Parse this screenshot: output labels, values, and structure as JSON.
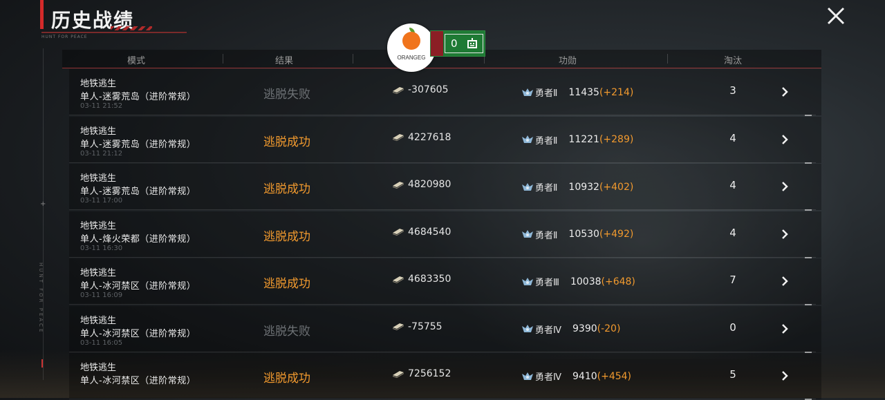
{
  "page": {
    "title": "历史战绩",
    "caption": "HUNT FOR PEACE"
  },
  "side_text": "HUNT FOR PEACE",
  "badge": {
    "brand": "ORANGEG",
    "score": "0"
  },
  "columns": {
    "mode": "模式",
    "result": "结果",
    "merit": "功勋",
    "eliminations": "淘汰"
  },
  "icons": {
    "close": "close-icon",
    "cash": "cash-icon",
    "rank": "rank-badge-icon",
    "row_arrow": "chevron-right-icon",
    "robot": "robot-icon"
  },
  "colors": {
    "success": "#f29a2e",
    "failure": "#6e7276",
    "accent_red": "#d42a2a",
    "delta": "#f29a2e"
  },
  "matches": [
    {
      "mode_line1": "地铁逃生",
      "mode_line2": "单人-迷雾荒岛（进阶常规）",
      "time": "03-11 21:52",
      "result": "逃脱失败",
      "status": "fail",
      "money": "-307605",
      "rank": "勇者Ⅱ",
      "merit": "11435",
      "merit_delta": "(+214)",
      "eliminations": "3"
    },
    {
      "mode_line1": "地铁逃生",
      "mode_line2": "单人-迷雾荒岛（进阶常规）",
      "time": "03-11 21:12",
      "result": "逃脱成功",
      "status": "ok",
      "money": "4227618",
      "rank": "勇者Ⅱ",
      "merit": "11221",
      "merit_delta": "(+289)",
      "eliminations": "4"
    },
    {
      "mode_line1": "地铁逃生",
      "mode_line2": "单人-迷雾荒岛（进阶常规）",
      "time": "03-11 17:00",
      "result": "逃脱成功",
      "status": "ok",
      "money": "4820980",
      "rank": "勇者Ⅱ",
      "merit": "10932",
      "merit_delta": "(+402)",
      "eliminations": "4"
    },
    {
      "mode_line1": "地铁逃生",
      "mode_line2": "单人-烽火荣都（进阶常规）",
      "time": "03-11 16:30",
      "result": "逃脱成功",
      "status": "ok",
      "money": "4684540",
      "rank": "勇者Ⅱ",
      "merit": "10530",
      "merit_delta": "(+492)",
      "eliminations": "4"
    },
    {
      "mode_line1": "地铁逃生",
      "mode_line2": "单人-冰河禁区（进阶常规）",
      "time": "03-11 16:09",
      "result": "逃脱成功",
      "status": "ok",
      "money": "4683350",
      "rank": "勇者Ⅲ",
      "merit": "10038",
      "merit_delta": "(+648)",
      "eliminations": "7"
    },
    {
      "mode_line1": "地铁逃生",
      "mode_line2": "单人-冰河禁区（进阶常规）",
      "time": "03-11 16:05",
      "result": "逃脱失败",
      "status": "fail",
      "money": "-75755",
      "rank": "勇者Ⅳ",
      "merit": "9390",
      "merit_delta": "(-20)",
      "eliminations": "0"
    },
    {
      "mode_line1": "地铁逃生",
      "mode_line2": "单人-冰河禁区（进阶常规）",
      "time": "",
      "result": "逃脱成功",
      "status": "ok",
      "money": "7256152",
      "rank": "勇者Ⅳ",
      "merit": "9410",
      "merit_delta": "(+454)",
      "eliminations": "5"
    }
  ]
}
